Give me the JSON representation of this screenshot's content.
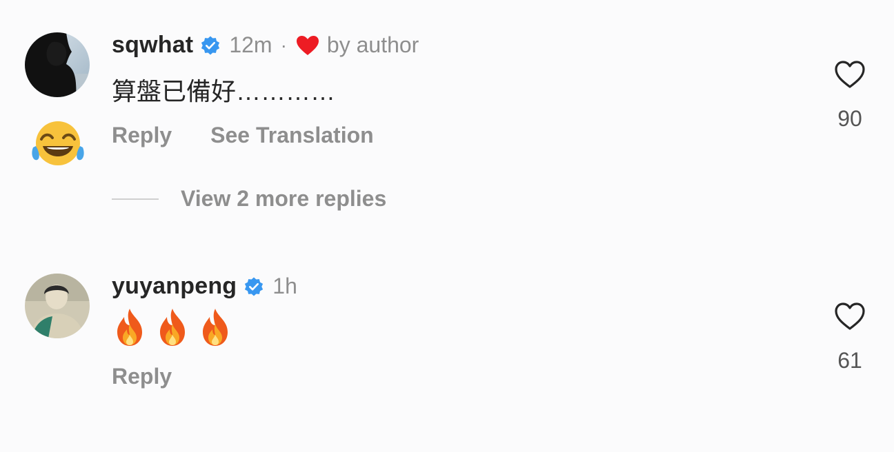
{
  "comments": [
    {
      "username": "sqwhat",
      "verified": true,
      "time": "12m",
      "separator": "·",
      "liked_by_author_label": "by author",
      "text": "算盤已備好…………",
      "actions": {
        "reply": "Reply",
        "see_translation": "See Translation"
      },
      "likes": "90",
      "view_replies": "View 2 more replies",
      "sticker": "tears-of-joy-emoji"
    },
    {
      "username": "yuyanpeng",
      "verified": true,
      "time": "1h",
      "text_emojis": [
        "fire-emoji",
        "fire-emoji",
        "fire-emoji"
      ],
      "actions": {
        "reply": "Reply"
      },
      "likes": "61"
    }
  ],
  "colors": {
    "background": "#fbfbfc",
    "primary_text": "#262626",
    "secondary_text": "#8e8e8e",
    "verified_blue": "#3897f0",
    "liked_red": "#ed1c24"
  }
}
